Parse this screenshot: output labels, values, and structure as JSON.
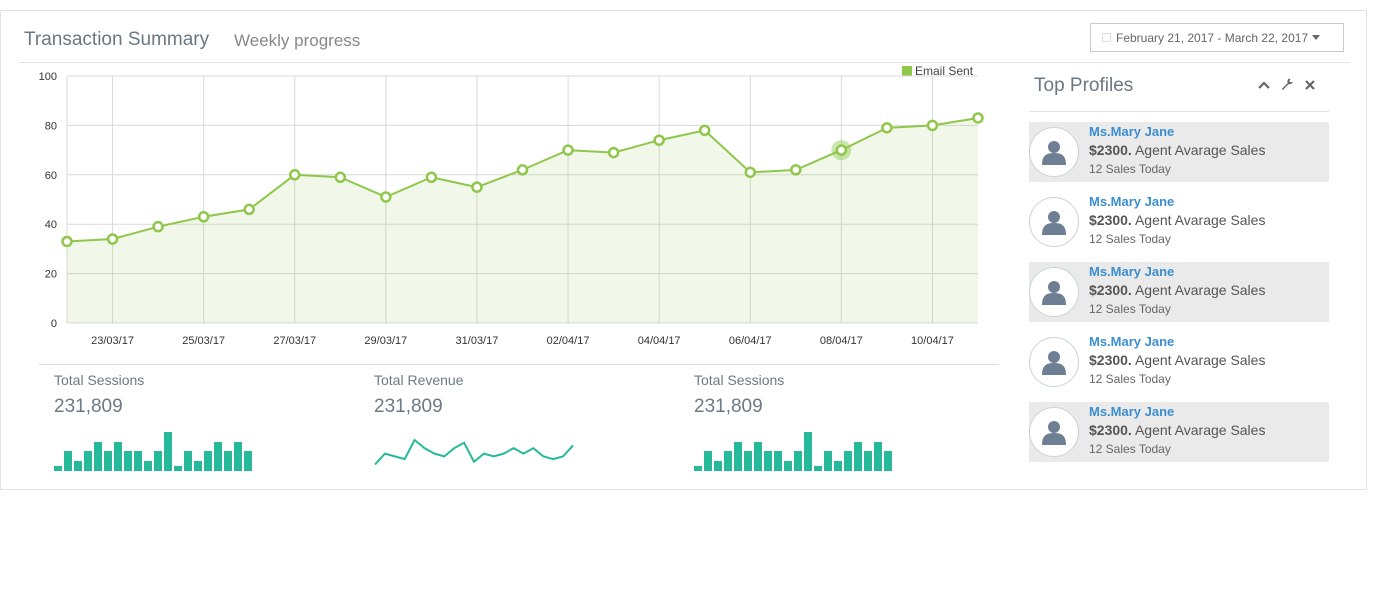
{
  "header": {
    "title": "Transaction Summary",
    "subtitle": "Weekly progress",
    "date_range": "February 21, 2017 - March 22, 2017"
  },
  "chart_data": {
    "type": "area",
    "legend": "Email Sent",
    "ylim": [
      0,
      100
    ],
    "yticks": [
      0,
      20,
      40,
      60,
      80,
      100
    ],
    "xtick_labels": [
      "23/03/17",
      "25/03/17",
      "27/03/17",
      "29/03/17",
      "31/03/17",
      "02/04/17",
      "04/04/17",
      "06/04/17",
      "08/04/17",
      "10/04/17"
    ],
    "series": [
      {
        "name": "Email Sent",
        "color": "#8fc74a",
        "x": [
          "22/03/17",
          "23/03/17",
          "24/03/17",
          "25/03/17",
          "26/03/17",
          "27/03/17",
          "28/03/17",
          "29/03/17",
          "30/03/17",
          "31/03/17",
          "01/04/17",
          "02/04/17",
          "03/04/17",
          "04/04/17",
          "05/04/17",
          "06/04/17",
          "07/04/17",
          "08/04/17",
          "09/04/17",
          "10/04/17",
          "11/04/17"
        ],
        "values": [
          33,
          34,
          39,
          43,
          46,
          60,
          59,
          51,
          59,
          55,
          62,
          70,
          69,
          74,
          78,
          61,
          62,
          70,
          79,
          80,
          83
        ]
      }
    ]
  },
  "stats": [
    {
      "label": "Total Sessions",
      "value": "231,809",
      "spark_type": "bar",
      "spark": [
        1,
        4,
        2,
        4,
        6,
        4,
        6,
        4,
        4,
        2,
        4,
        8,
        1,
        4,
        2,
        4,
        6,
        4,
        6,
        4,
        2
      ]
    },
    {
      "label": "Total Revenue",
      "value": "231,809",
      "spark_type": "line",
      "spark": [
        2,
        6,
        5,
        4,
        11,
        8,
        6,
        5,
        8,
        10,
        3,
        6,
        5,
        6,
        8,
        6,
        8,
        5,
        4,
        5,
        9
      ]
    },
    {
      "label": "Total Sessions",
      "value": "231,809",
      "spark_type": "bar",
      "spark": [
        1,
        4,
        2,
        4,
        6,
        4,
        6,
        4,
        4,
        2,
        4,
        8,
        1,
        4,
        2,
        4,
        6,
        4,
        6,
        4,
        2
      ]
    }
  ],
  "profiles": {
    "title": "Top Profiles",
    "items": [
      {
        "name": "Ms.Mary Jane",
        "amount": "$2300.",
        "sales_text": "Agent Avarage Sales",
        "today": "12 Sales Today"
      },
      {
        "name": "Ms.Mary Jane",
        "amount": "$2300.",
        "sales_text": "Agent Avarage Sales",
        "today": "12 Sales Today"
      },
      {
        "name": "Ms.Mary Jane",
        "amount": "$2300.",
        "sales_text": "Agent Avarage Sales",
        "today": "12 Sales Today"
      },
      {
        "name": "Ms.Mary Jane",
        "amount": "$2300.",
        "sales_text": "Agent Avarage Sales",
        "today": "12 Sales Today"
      },
      {
        "name": "Ms.Mary Jane",
        "amount": "$2300.",
        "sales_text": "Agent Avarage Sales",
        "today": "12 Sales Today"
      }
    ]
  },
  "colors": {
    "accent": "#8fc74a",
    "spark": "#26b99a",
    "link": "#3b8ed0"
  }
}
